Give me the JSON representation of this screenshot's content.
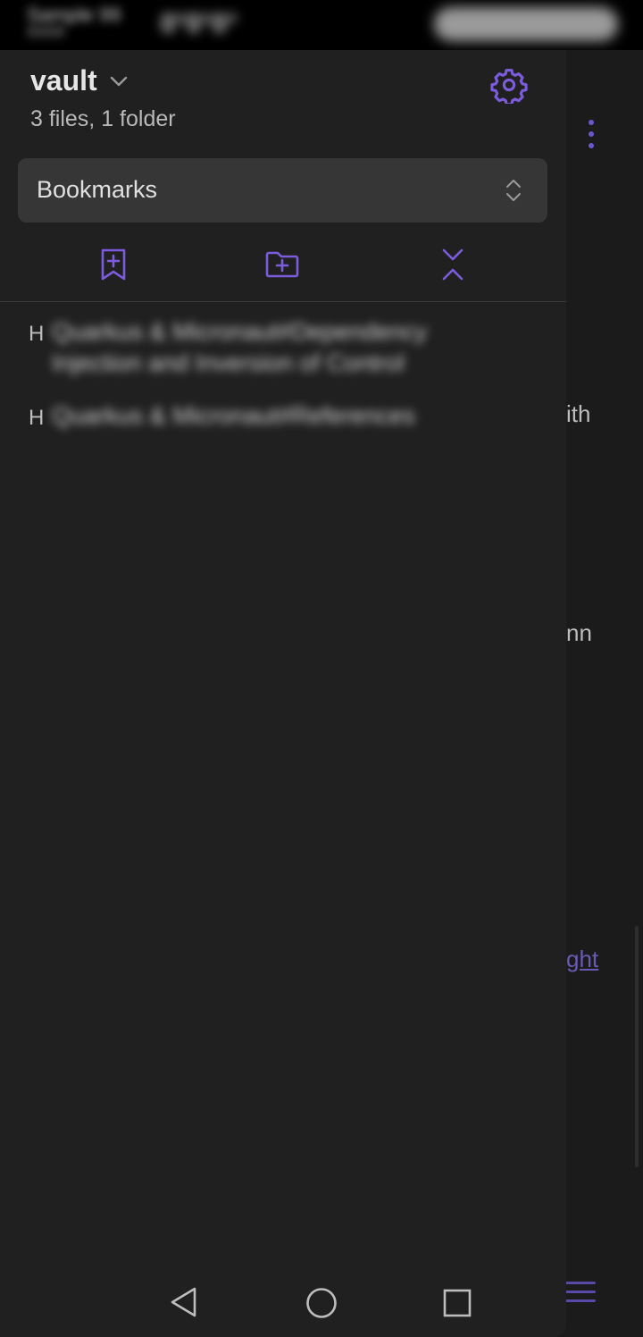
{
  "status_bar": {
    "left_top": "Sample 99",
    "left_bottom": "XXXX",
    "middle": "0°0°0°"
  },
  "editor_background": {
    "fragment_1": "ith",
    "fragment_2": "nn",
    "fragment_link": "ght"
  },
  "drawer": {
    "vault": {
      "name": "vault",
      "stats": "3 files, 1 folder"
    },
    "view_selector": {
      "value": "Bookmarks"
    },
    "actions": [
      {
        "icon": "bookmark-plus-icon"
      },
      {
        "icon": "folder-plus-icon"
      },
      {
        "icon": "collapse-all-icon"
      }
    ],
    "bookmarks": [
      {
        "type": "H",
        "text": "Quarkus & Micronaut#Dependency Injection and Inversion of Control"
      },
      {
        "type": "H",
        "text": "Quarkus & Micronaut#References"
      }
    ]
  },
  "colors": {
    "accent": "#7c5cdc",
    "drawer_bg": "#202020",
    "select_bg": "#363636"
  }
}
